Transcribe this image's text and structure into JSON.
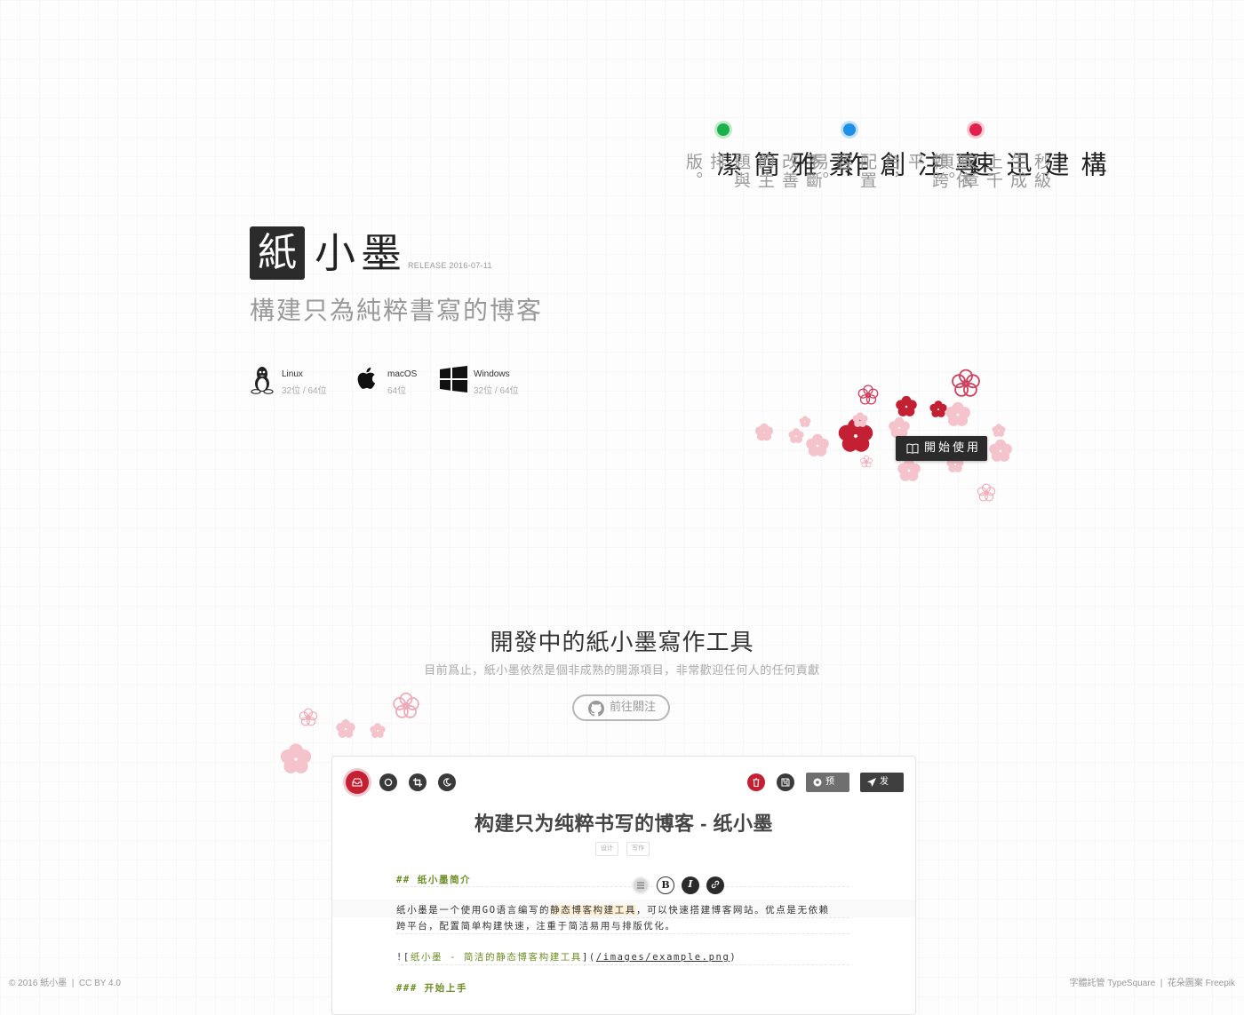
{
  "brand": {
    "logo_char": "紙",
    "name": "小墨",
    "release": "RELEASE 2016-07-11",
    "tagline": "構建只為純粹書寫的博客"
  },
  "platforms": [
    {
      "icon": "linux-icon",
      "name": "Linux",
      "bits": "32位 / 64位"
    },
    {
      "icon": "apple-icon",
      "name": "macOS",
      "bits": "64位"
    },
    {
      "icon": "windows-icon",
      "name": "Windows",
      "bits": "32位 / 64位"
    }
  ],
  "features": [
    {
      "title": "素雅簡潔",
      "desc": "不斷改善的主題與排版。",
      "dot_color": "#1ab04a"
    },
    {
      "title": "專注創作",
      "desc": "無依賴跨平台，配置容易。",
      "dot_color": "#1e90e8"
    },
    {
      "title": "構建迅速",
      "desc": "秒級生成上千文章頁。",
      "dot_color": "#e0204e"
    }
  ],
  "start_button": {
    "label": "開始使用",
    "icon": "book-icon"
  },
  "dev_section": {
    "title": "開發中的紙小墨寫作工具",
    "subtitle": "目前爲止，紙小墨依然是個非成熟的開源項目，非常歡迎任何人的任何貢獻",
    "follow_label": "前往關注",
    "follow_icon": "github-icon"
  },
  "editor": {
    "toolbar_left": [
      "inbox-icon",
      "circle-icon",
      "crop-icon",
      "moon-icon"
    ],
    "toolbar_right": {
      "delete_icon": "trash-icon",
      "save_icon": "save-icon",
      "preview_label": "预览",
      "publish_label": "发布"
    },
    "doc_title": "构建只为纯粹书写的博客 - 纸小墨",
    "tags": [
      "设计",
      "写作"
    ],
    "format_buttons": [
      "heading-icon",
      "B",
      "I",
      "link-icon"
    ],
    "heading1": "## 纸小墨简介",
    "para_part1": "纸小墨是一个使用GO语言编写的",
    "para_highlight": "静态博客构建工具",
    "para_part2": "，可以快速搭建博客网站。优点是无依赖",
    "para_line2": "跨平台，配置简单构建快速，注重于简洁易用与排版优化。",
    "img_prefix": "![",
    "img_alt": "纸小墨 - 简洁的静态博客构建工具",
    "img_mid": "](",
    "img_url": "/images/example.png",
    "img_suffix": ")",
    "heading2": "### 开始上手"
  },
  "footer": {
    "left": "© 2016 紙小墨  |  CC BY 4.0",
    "right": "字體託管 TypeSquare  |  花朵圖案 Freepik"
  },
  "colors": {
    "dark": "#2b2b2b",
    "accent_red": "#c42033",
    "preview_btn": "#6f6f6f",
    "publish_btn": "#3f3f3f",
    "markdown_green": "#6b8e23"
  }
}
